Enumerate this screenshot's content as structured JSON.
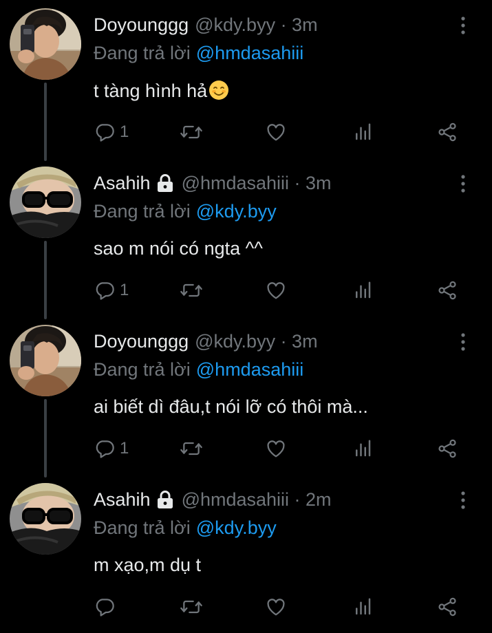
{
  "colors": {
    "background": "#000000",
    "primary_text": "#e7e9ea",
    "secondary_text": "#71767b",
    "link": "#1d9bf0",
    "thread_line": "#3a3f44"
  },
  "tweets": [
    {
      "display_name": "Doyounggg",
      "protected": false,
      "meta": "@kdy.byy · 3m",
      "replying_label": "Đang trả lời",
      "replying_handle": "@hmdasahiii",
      "text": "t tàng hình hả",
      "has_emoji": true,
      "emoji_icon": "smiling-face-emoji",
      "reply_count": "1",
      "avatar_icon": "doyounggg-avatar"
    },
    {
      "display_name": "Asahih",
      "protected": true,
      "meta": "@hmdasahiii · 3m",
      "replying_label": "Đang trả lời",
      "replying_handle": "@kdy.byy",
      "text": "sao m nói có ngta ^^",
      "has_emoji": false,
      "reply_count": "1",
      "avatar_icon": "asahih-avatar"
    },
    {
      "display_name": "Doyounggg",
      "protected": false,
      "meta": "@kdy.byy · 3m",
      "replying_label": "Đang trả lời",
      "replying_handle": "@hmdasahiii",
      "text": "ai biết dì đâu,t nói lỡ có thôi mà...",
      "has_emoji": false,
      "reply_count": "1",
      "avatar_icon": "doyounggg-avatar"
    },
    {
      "display_name": "Asahih",
      "protected": true,
      "meta": "@hmdasahiii · 2m",
      "replying_label": "Đang trả lời",
      "replying_handle": "@kdy.byy",
      "text": "m xạo,m dụ t",
      "has_emoji": false,
      "reply_count": "",
      "avatar_icon": "asahih-avatar"
    }
  ],
  "icons": {
    "reply": "reply-icon",
    "retweet": "retweet-icon",
    "like": "like-icon",
    "analytics": "analytics-icon",
    "share": "share-icon",
    "more": "more-icon",
    "lock": "lock-icon"
  }
}
